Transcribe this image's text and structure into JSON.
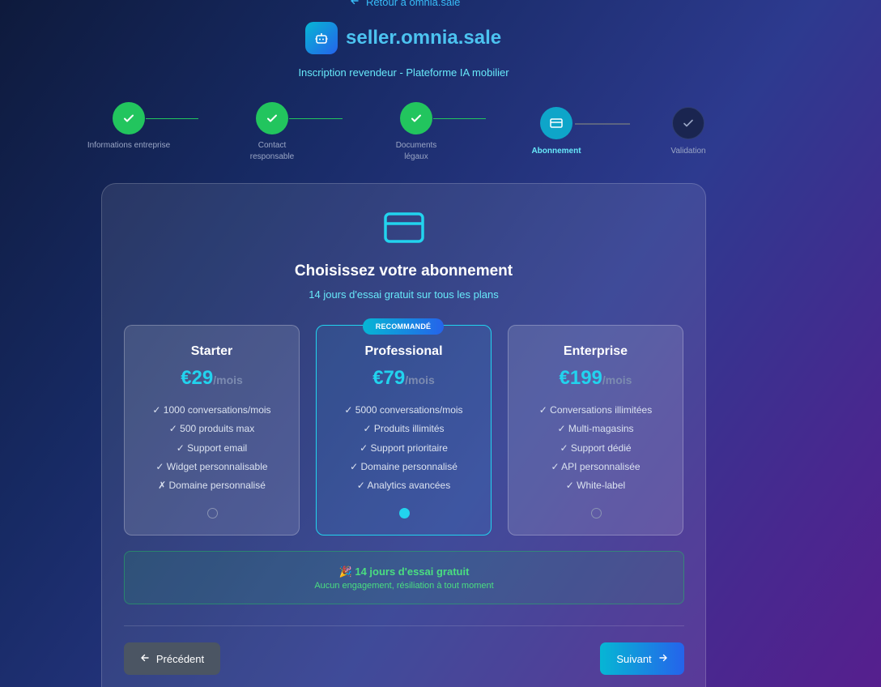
{
  "header": {
    "back_link": "Retour à omnia.sale",
    "brand_name": "seller.omnia.sale",
    "subtitle": "Inscription revendeur - Plateforme IA mobilier"
  },
  "steps": [
    {
      "label": "Informations entreprise",
      "status": "done"
    },
    {
      "label": "Contact responsable",
      "status": "done"
    },
    {
      "label": "Documents légaux",
      "status": "done"
    },
    {
      "label": "Abonnement",
      "status": "active"
    },
    {
      "label": "Validation",
      "status": "pending"
    }
  ],
  "card": {
    "icon": "credit-card-icon",
    "title": "Choisissez votre abonnement",
    "subtitle": "14 jours d'essai gratuit sur tous les plans"
  },
  "plans": [
    {
      "name": "Starter",
      "price": "€29",
      "period": "/mois",
      "selected": false,
      "features": [
        "✓ 1000 conversations/mois",
        "✓ 500 produits max",
        "✓ Support email",
        "✓ Widget personnalisable",
        "✗ Domaine personnalisé"
      ]
    },
    {
      "name": "Professional",
      "badge": "RECOMMANDÉ",
      "price": "€79",
      "period": "/mois",
      "selected": true,
      "features": [
        "✓ 5000 conversations/mois",
        "✓ Produits illimités",
        "✓ Support prioritaire",
        "✓ Domaine personnalisé",
        "✓ Analytics avancées"
      ]
    },
    {
      "name": "Enterprise",
      "price": "€199",
      "period": "/mois",
      "selected": false,
      "features": [
        "✓ Conversations illimitées",
        "✓ Multi-magasins",
        "✓ Support dédié",
        "✓ API personnalisée",
        "✓ White-label"
      ]
    }
  ],
  "trial": {
    "title": "🎉 14 jours d'essai gratuit",
    "subtitle": "Aucun engagement, résiliation à tout moment"
  },
  "buttons": {
    "prev": "Précédent",
    "next": "Suivant"
  },
  "colors": {
    "accent": "#22d3ee",
    "success": "#22c55e",
    "brand_gradient_start": "#06b6d4",
    "brand_gradient_end": "#2563eb"
  }
}
